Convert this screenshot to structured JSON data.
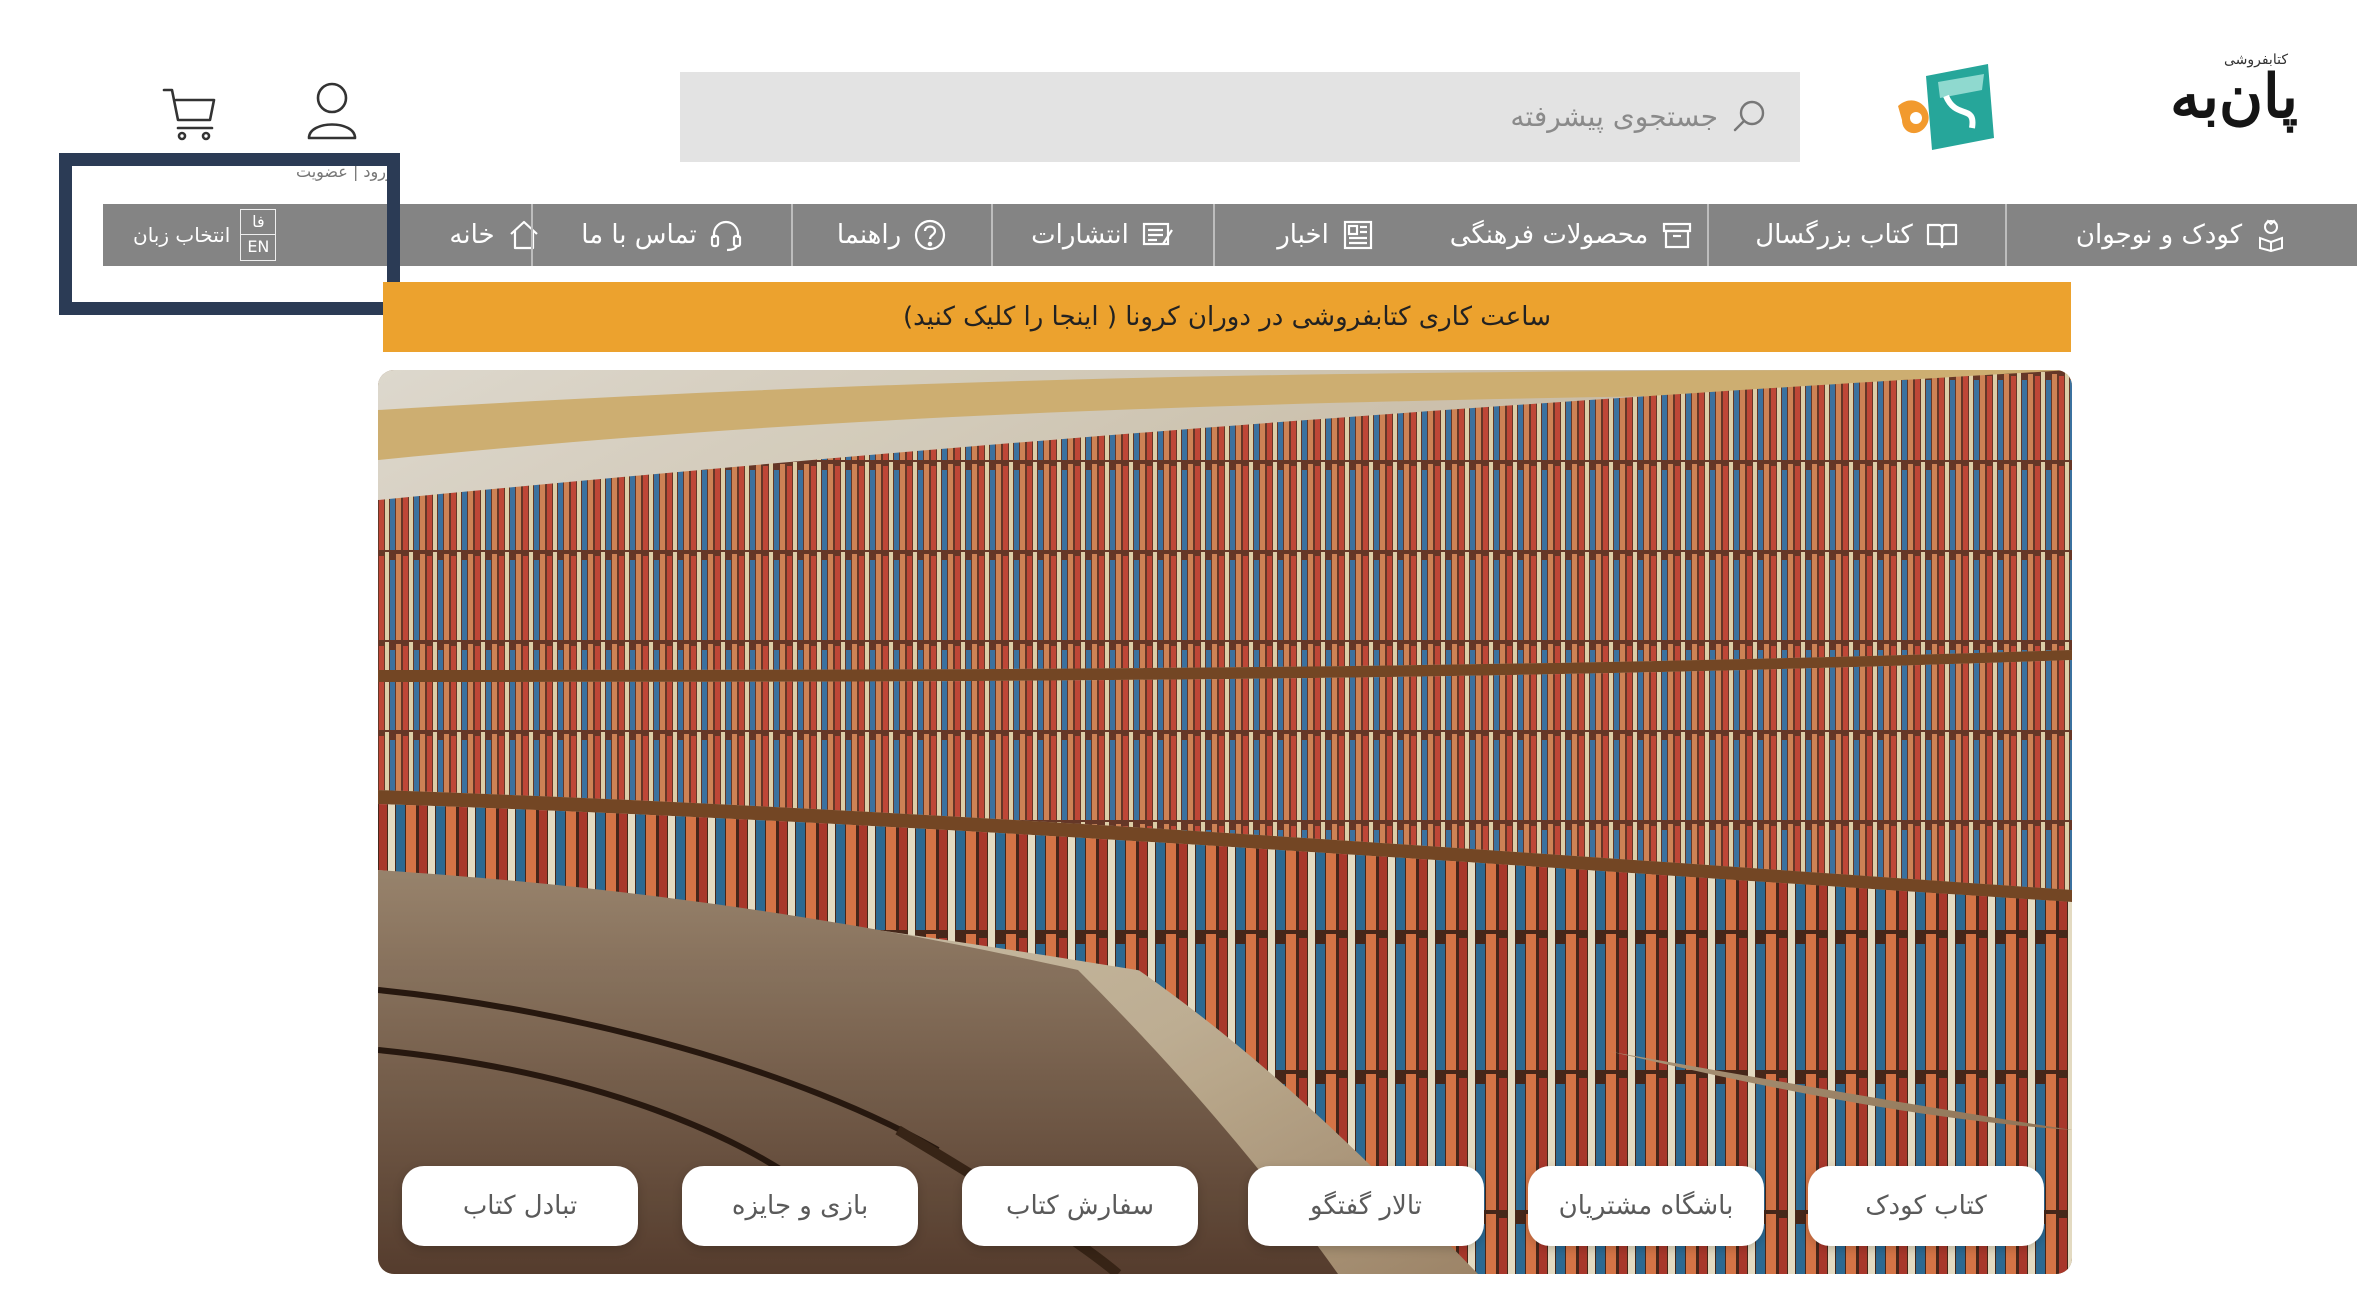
{
  "header": {
    "user_caption": "ورود | عضویت",
    "search_placeholder": "جستجوی پیشرفته",
    "logo_small": "کتابفروشی",
    "logo_big": "پان‌به"
  },
  "nav": {
    "items": [
      {
        "label": "کودک و نوجوان",
        "icon": "child-reader-icon"
      },
      {
        "label": "کتاب بزرگسال",
        "icon": "open-book-icon"
      },
      {
        "label": "محصولات فرهنگی",
        "icon": "box-icon"
      },
      {
        "label": "اخبار",
        "icon": "newspaper-icon"
      },
      {
        "label": "انتشارات",
        "icon": "publishing-icon"
      },
      {
        "label": "راهنما",
        "icon": "question-icon"
      },
      {
        "label": "تماس با ما",
        "icon": "headset-icon"
      },
      {
        "label": "خانه",
        "icon": "home-icon"
      }
    ],
    "language": {
      "label": "انتخاب زبان",
      "fa": "فا",
      "en": "EN"
    }
  },
  "notice": "ساعت کاری کتابفروشی در دوران کرونا ( اینجا را کلیک کنید)",
  "hero_buttons": [
    "کتاب کودک",
    "باشگاه مشتریان",
    "تالار گفتگو",
    "سفارش کتاب",
    "بازی و جایزه",
    "تبادل کتاب"
  ],
  "colors": {
    "nav_bg": "#848484",
    "notice_bg": "#eca22e",
    "search_bg": "#e3e3e3",
    "highlight_frame": "#2b3b55",
    "logo_teal": "#26a69a",
    "logo_orange": "#f29a2e"
  }
}
